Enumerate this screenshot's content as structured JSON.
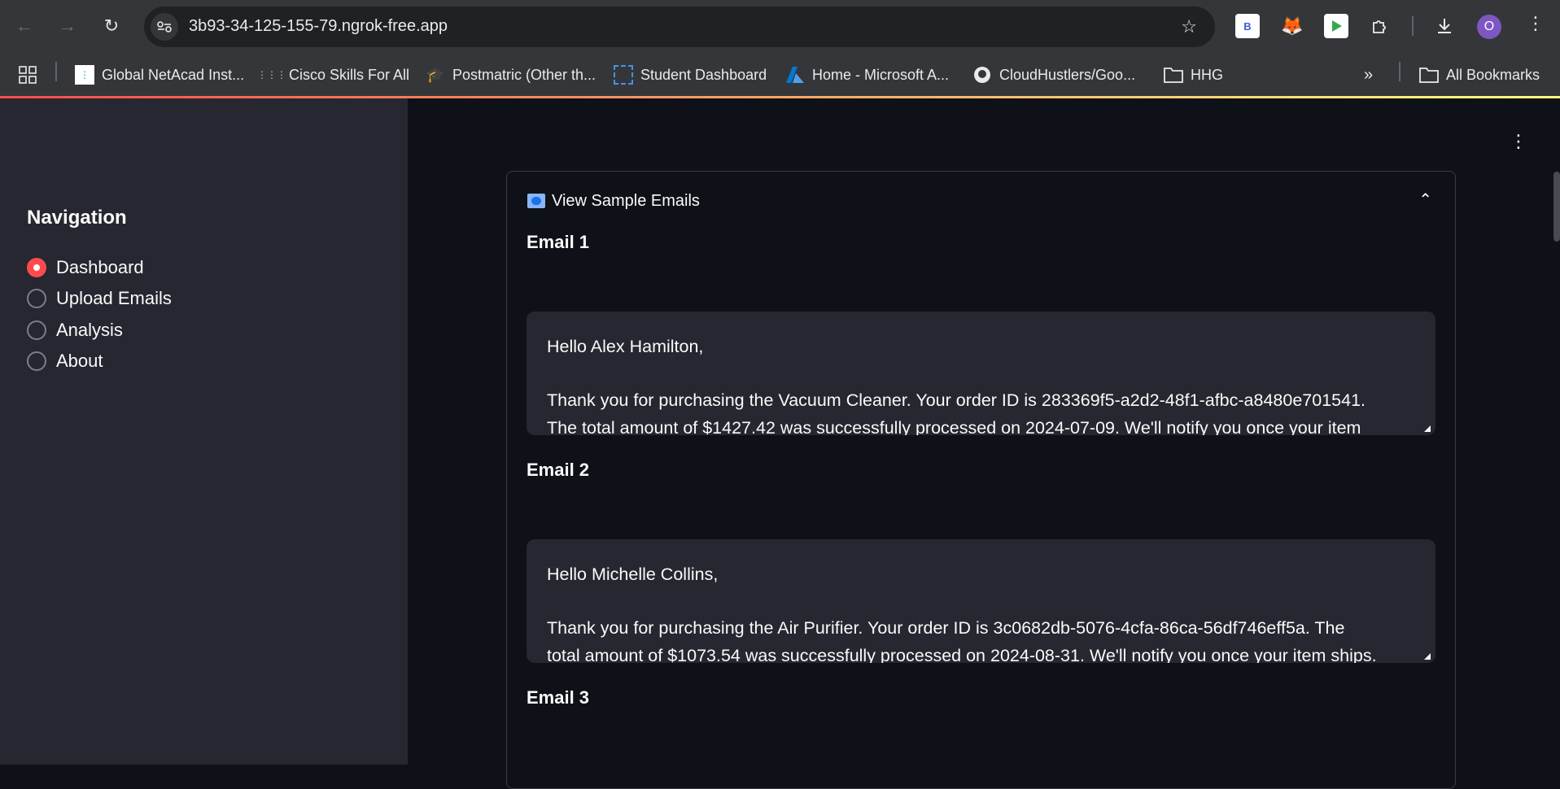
{
  "browser": {
    "url": "3b93-34-125-155-79.ngrok-free.app",
    "profile_initial": "O",
    "bookmarks": [
      {
        "label": "Global NetAcad Inst...",
        "icon": "cisco-netacad-icon"
      },
      {
        "label": "Cisco Skills For All",
        "icon": "cisco-icon"
      },
      {
        "label": "Postmatric (Other th...",
        "icon": "graduation-cap-icon"
      },
      {
        "label": "Student Dashboard",
        "icon": "dashboard-icon"
      },
      {
        "label": "Home - Microsoft A...",
        "icon": "azure-icon"
      },
      {
        "label": "CloudHustlers/Goo...",
        "icon": "github-icon"
      },
      {
        "label": "HHG",
        "icon": "folder-icon"
      }
    ],
    "all_bookmarks": "All Bookmarks"
  },
  "sidebar": {
    "title": "Navigation",
    "items": [
      {
        "label": "Dashboard",
        "selected": true
      },
      {
        "label": "Upload Emails",
        "selected": false
      },
      {
        "label": "Analysis",
        "selected": false
      },
      {
        "label": "About",
        "selected": false
      }
    ]
  },
  "expander": {
    "title": "View Sample Emails",
    "emails": [
      {
        "label": "Email 1",
        "greeting": "Hello Alex Hamilton,",
        "line1": "Thank you for purchasing the Vacuum Cleaner. Your order ID is 283369f5-a2d2-48f1-afbc-a8480e701541.",
        "line2": "The total amount of $1427.42 was successfully processed on 2024-07-09. We'll notify you once your item"
      },
      {
        "label": "Email 2",
        "greeting": "Hello Michelle Collins,",
        "line1": "Thank you for purchasing the Air Purifier. Your order ID is 3c0682db-5076-4cfa-86ca-56df746eff5a. The",
        "line2": "total amount of $1073.54 was successfully processed on 2024-08-31. We'll notify you once your item ships."
      },
      {
        "label": "Email 3"
      }
    ]
  },
  "colors": {
    "accent": "#ff4b4b",
    "sidebar_bg": "#262730",
    "main_bg": "#0e1117"
  }
}
